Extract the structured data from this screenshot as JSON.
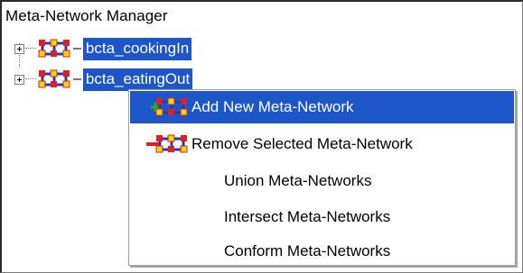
{
  "panel": {
    "title": "Meta-Network Manager"
  },
  "tree": {
    "nodes": [
      {
        "label": "bcta_cookingIn",
        "icon": "meta-network-icon",
        "dash": "–"
      },
      {
        "label": "bcta_eatingOut",
        "icon": "meta-network-icon",
        "dash": "–"
      }
    ]
  },
  "context_menu": {
    "items": [
      {
        "label": "Add New Meta-Network",
        "icon": "add-meta-network-icon",
        "highlighted": true
      },
      {
        "label": "Remove Selected Meta-Network",
        "icon": "remove-meta-network-icon",
        "highlighted": false
      },
      {
        "label": "Union Meta-Networks",
        "icon": "",
        "highlighted": false
      },
      {
        "label": "Intersect Meta-Networks",
        "icon": "",
        "highlighted": false
      },
      {
        "label": "Conform Meta-Networks",
        "icon": "",
        "highlighted": false
      }
    ]
  },
  "colors": {
    "selection": "#1c56c9",
    "node_red": "#e0201b",
    "node_yellow": "#f5d800",
    "link_blue": "#1a3cc8"
  }
}
